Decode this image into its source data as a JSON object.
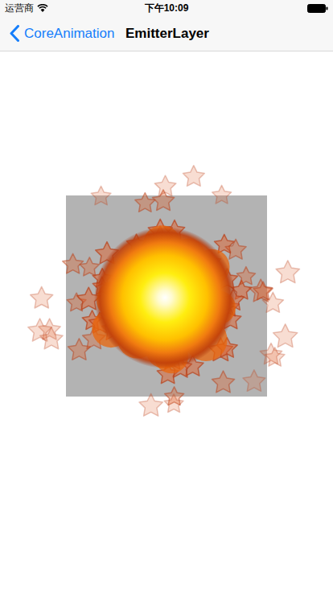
{
  "status_bar": {
    "carrier": "运营商",
    "time": "下午10:09"
  },
  "nav_bar": {
    "back": "CoreAnimation",
    "title": "EmitterLayer"
  }
}
